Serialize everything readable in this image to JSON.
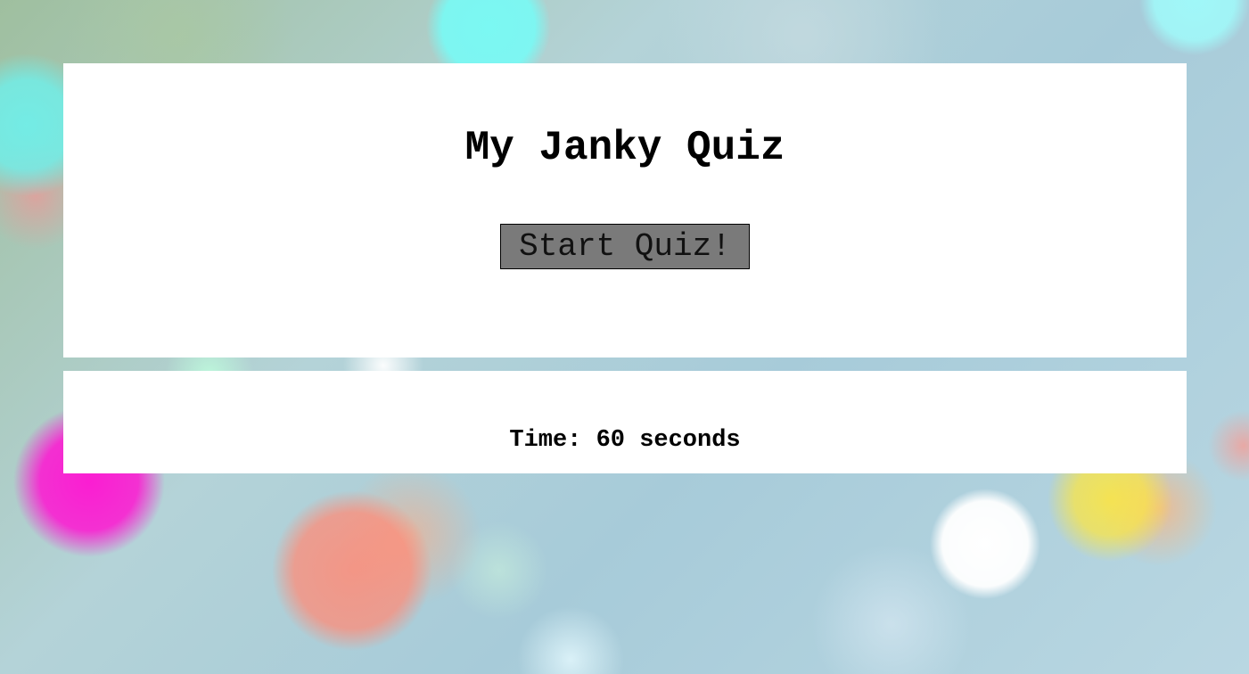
{
  "header": {
    "title": "My Janky Quiz",
    "start_label": "Start Quiz!"
  },
  "timer": {
    "label": "Time:",
    "value": 60,
    "unit": "seconds",
    "text": "Time: 60 seconds"
  }
}
